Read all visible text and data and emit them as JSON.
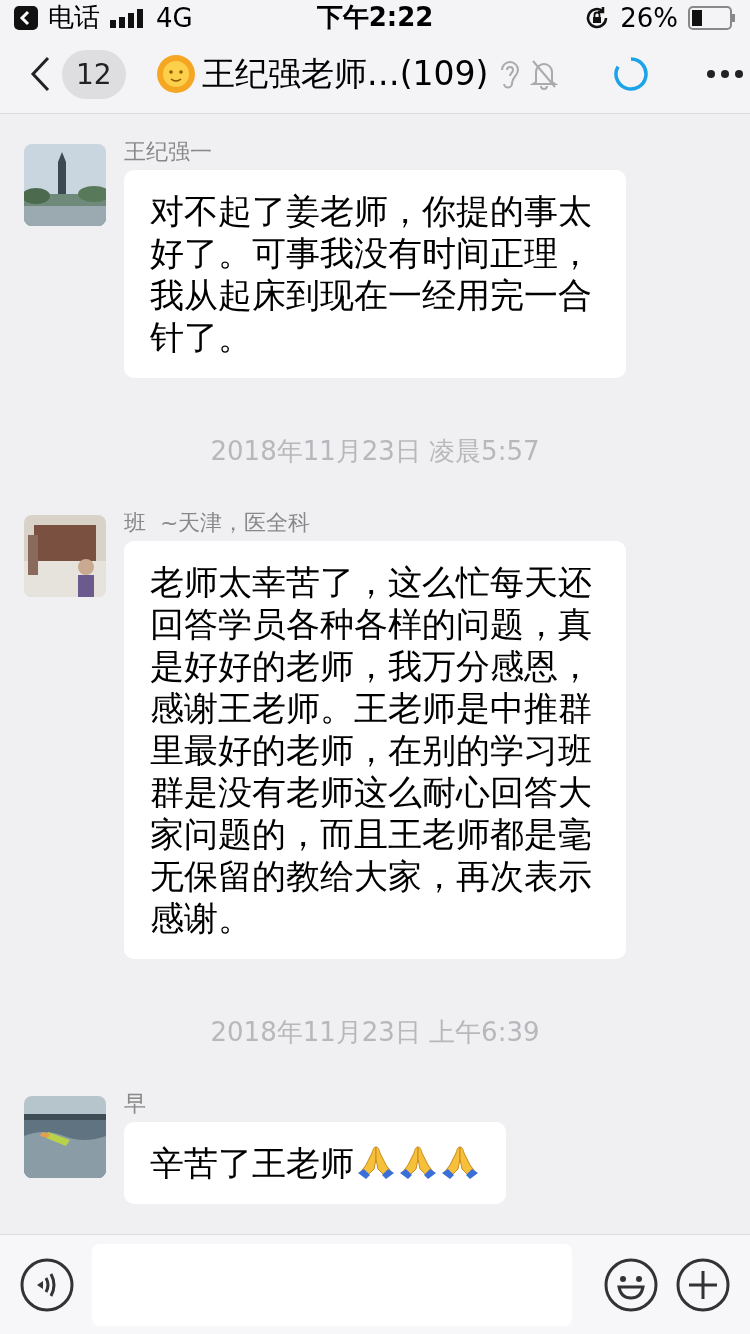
{
  "status_bar": {
    "back_app": "电话",
    "network": "4G",
    "time": "下午2:22",
    "battery": "26%"
  },
  "nav": {
    "unread": "12",
    "title": "王纪强老师…(109)"
  },
  "messages": [
    {
      "kind": "message",
      "sender": "王纪强一",
      "avatar": {
        "kind": "picture"
      },
      "parts": [
        {
          "kind": "text",
          "text": "对不起了姜老师，你提的事太好了。可事我没有时间正理，我从起床到现在一经用完一合针了。"
        }
      ]
    },
    {
      "kind": "time",
      "text": "2018年11月23日 凌晨5:57"
    },
    {
      "kind": "message",
      "sender": "班",
      "sender_suffix": "~天津，医全科",
      "avatar": {
        "kind": "picture"
      },
      "parts": [
        {
          "kind": "text",
          "text": "老师太幸苦了，这么忙每天还回答学员各种各样的问题，真是好好的老师，我万分感恩，感谢王老师。王老师是中推群里最好的老师，在别的学习班群是没有老师这么耐心回答大家问题的，而且王老师都是毫无保留的教给大家，再次表示感谢。"
        }
      ]
    },
    {
      "kind": "time",
      "text": "2018年11月23日 上午6:39"
    },
    {
      "kind": "message",
      "sender": "早",
      "avatar": {
        "kind": "picture"
      },
      "parts": [
        {
          "kind": "text",
          "text": "辛苦了王老师"
        },
        {
          "kind": "pray"
        },
        {
          "kind": "pray"
        },
        {
          "kind": "pray"
        }
      ]
    }
  ]
}
